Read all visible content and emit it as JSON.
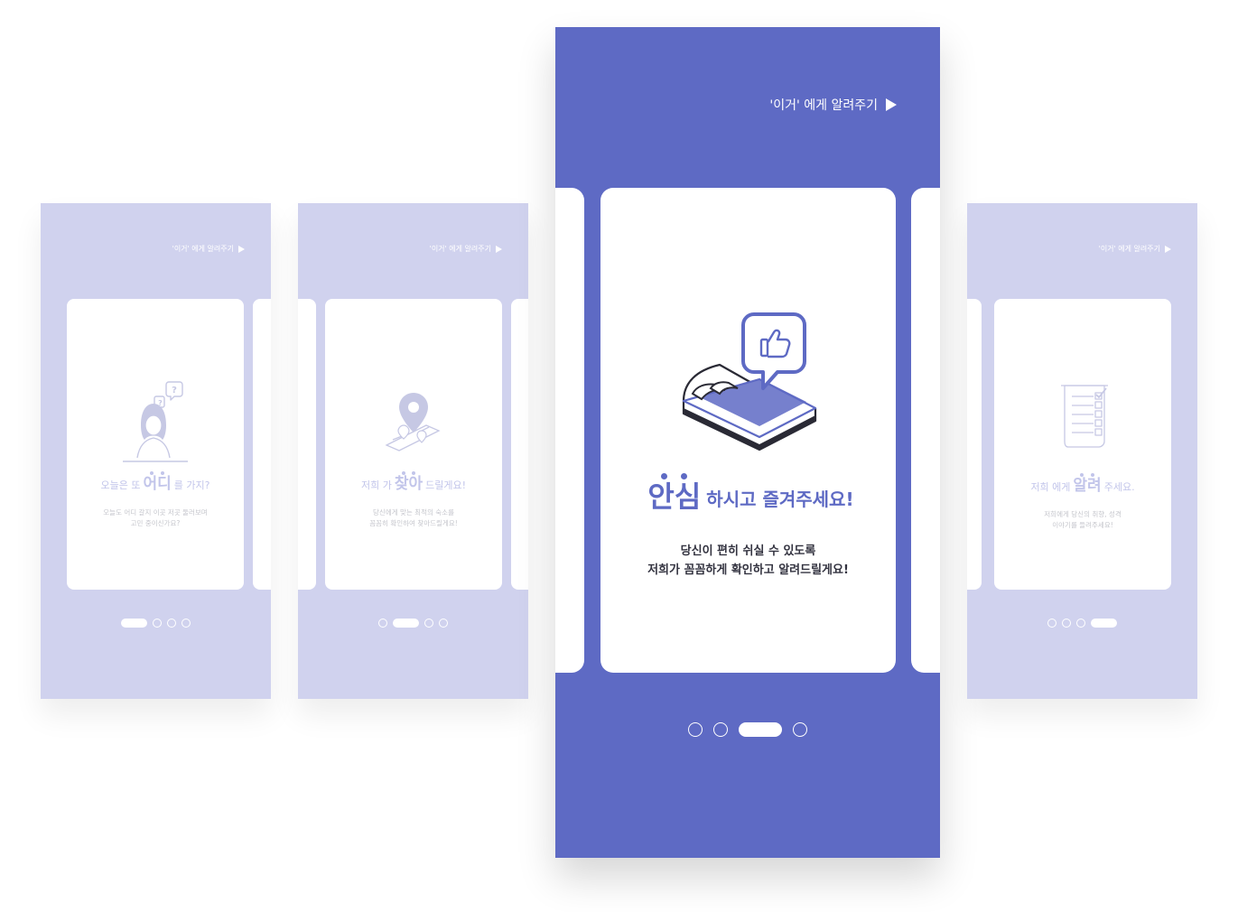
{
  "colors": {
    "accent": "#5e6ac4",
    "faded_bg": "#d0d2ee",
    "card": "#ffffff"
  },
  "screens": [
    {
      "hint": "'이거' 에게 알려주기",
      "title_pre": "오늘은 또",
      "title_emph": "어디",
      "title_post": "를 가지?",
      "desc_line1": "오늘도 어디 갈지 이곳 저곳 둘러보며",
      "desc_line2": "고민 중이신가요?",
      "illustration": "girl-question-icon",
      "page_active": 1
    },
    {
      "hint": "'이거' 에게 알려주기",
      "title_pre": "저희 가",
      "title_emph": "찾아",
      "title_post": "드릴게요!",
      "desc_line1": "당신에게 맞는 최적의 숙소를",
      "desc_line2": "꼼꼼히 확인하여 찾아드릴게요!",
      "illustration": "map-pin-icon",
      "page_active": 2
    },
    {
      "hint": "'이거' 에게 알려주기",
      "title_pre": "",
      "title_emph": "안심",
      "title_post": "하시고 즐겨주세요!",
      "desc_line1": "당신이 편히 쉬실 수 있도록",
      "desc_line2": "저희가 꼼꼼하게 확인하고 알려드릴게요!",
      "illustration": "bed-thumbs-up-icon",
      "page_active": 3
    },
    {
      "hint": "'이거' 에게 알려주기",
      "title_pre": "저희 에게",
      "title_emph": "알려",
      "title_post": "주세요.",
      "desc_line1": "저희에게 당신의 취향, 성격",
      "desc_line2": "이야기를 들려주세요!",
      "illustration": "checklist-icon",
      "page_active": 4
    }
  ]
}
